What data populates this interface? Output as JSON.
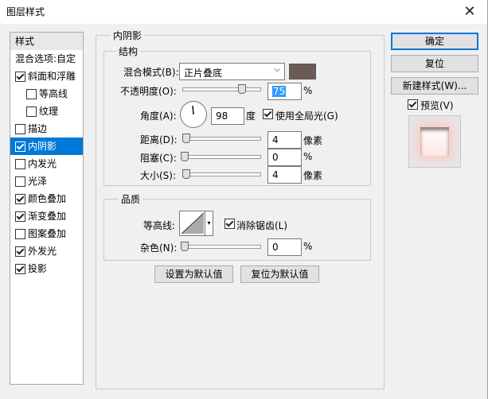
{
  "window": {
    "title": "图层样式",
    "close_glyph": "✕"
  },
  "styles_list": {
    "header": "样式",
    "blend_options": "混合选项:自定",
    "items": [
      {
        "label": "斜面和浮雕",
        "checked": true
      },
      {
        "label": "等高线",
        "checked": false
      },
      {
        "label": "纹理",
        "checked": false
      },
      {
        "label": "描边",
        "checked": false
      },
      {
        "label": "内阴影",
        "checked": true
      },
      {
        "label": "内发光",
        "checked": false
      },
      {
        "label": "光泽",
        "checked": false
      },
      {
        "label": "颜色叠加",
        "checked": true
      },
      {
        "label": "渐变叠加",
        "checked": true
      },
      {
        "label": "图案叠加",
        "checked": false
      },
      {
        "label": "外发光",
        "checked": true
      },
      {
        "label": "投影",
        "checked": true
      }
    ]
  },
  "inner_shadow": {
    "group_title": "内阴影",
    "structure": {
      "title": "结构",
      "blend_mode_label": "混合模式(B):",
      "blend_mode_value": "正片叠底",
      "shadow_color": "#6d5a56",
      "opacity_label": "不透明度(O):",
      "opacity_value": "75",
      "opacity_unit": "%",
      "angle_label": "角度(A):",
      "angle_value": "98",
      "angle_unit": "度",
      "global_light_label": "使用全局光(G)",
      "global_light_checked": true,
      "distance_label": "距离(D):",
      "distance_value": "4",
      "distance_unit": "像素",
      "choke_label": "阻塞(C):",
      "choke_value": "0",
      "choke_unit": "%",
      "size_label": "大小(S):",
      "size_value": "4",
      "size_unit": "像素"
    },
    "quality": {
      "title": "品质",
      "contour_label": "等高线:",
      "anti_alias_label": "消除锯齿(L)",
      "anti_alias_checked": true,
      "noise_label": "杂色(N):",
      "noise_value": "0",
      "noise_unit": "%"
    },
    "set_default": "设置为默认值",
    "reset_default": "复位为默认值"
  },
  "actions": {
    "ok": "确定",
    "reset": "复位",
    "new_style": "新建样式(W)...",
    "preview_label": "预览(V)",
    "preview_checked": true
  }
}
